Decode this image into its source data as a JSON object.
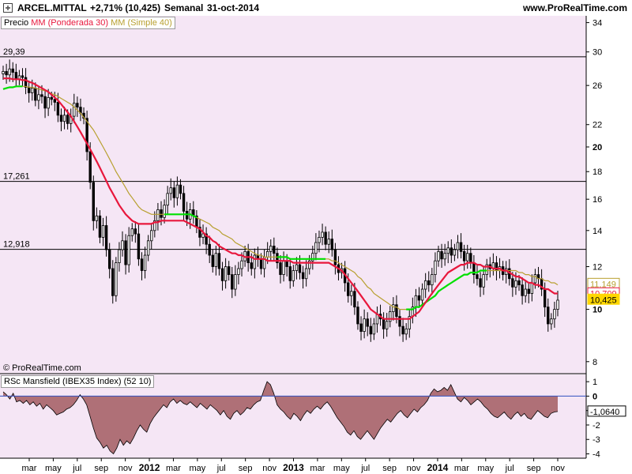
{
  "header": {
    "instrument": "ARCEL.MITTAL",
    "change": "+2,71% (10,425)",
    "period": "Semanal",
    "date": "31-oct-2014",
    "site": "www.ProRealTime.com"
  },
  "legend": {
    "price": "Precio",
    "ma30": "MM (Ponderada 30)",
    "ma40": "MM (Simple 40)",
    "rsc": "RSc Mansfield (IBEX35 Index) (52 10)"
  },
  "watermark": "© ProRealTime.com",
  "colors": {
    "background": "#f5e6f5",
    "candle_up": "#ffffff",
    "candle_down": "#000000",
    "ma30": "#e8173c",
    "ma40_up": "#00e000",
    "ma40": "#b8a030",
    "rsc_fill": "#a25a60",
    "rsc_fill_pos": "#7a9a7a",
    "price_tag": "#ffd700"
  },
  "icons": {
    "expand": "expand-icon"
  },
  "chart_data": [
    {
      "type": "candlestick",
      "title": "",
      "y_axis_ticks": [
        8,
        10,
        12,
        14,
        16,
        18,
        20,
        22,
        26,
        30,
        34
      ],
      "y_axis_bold": [
        10,
        20
      ],
      "ylim": [
        7.6,
        35
      ],
      "log_scale": true,
      "x_labels": [
        "mar",
        "may",
        "jul",
        "sep",
        "nov",
        "2012",
        "mar",
        "may",
        "jul",
        "sep",
        "nov",
        "2013",
        "mar",
        "may",
        "jul",
        "sep",
        "nov",
        "2014",
        "mar",
        "may",
        "jul",
        "sep",
        "nov"
      ],
      "x_bold": [
        "2012",
        "2013",
        "2014"
      ],
      "horizontal_lines": [
        {
          "value": 29.39,
          "label": "29,39"
        },
        {
          "value": 17.261,
          "label": "17,261"
        },
        {
          "value": 12.918,
          "label": "12,918"
        }
      ],
      "right_tags": [
        {
          "value": 11.149,
          "label": "11,149",
          "color": "#b8a030"
        },
        {
          "value": 10.709,
          "label": "10,709",
          "color": "#e8173c"
        },
        {
          "value": 10.425,
          "label": "10,425",
          "color": "#ffd700"
        }
      ],
      "close": [
        27.6,
        27.2,
        27.9,
        27.5,
        26.7,
        27.1,
        26.9,
        25.8,
        25.2,
        25.7,
        24.4,
        25.0,
        24.8,
        23.6,
        24.7,
        24.5,
        24.2,
        22.9,
        22.3,
        22.9,
        22.1,
        22.8,
        24.1,
        23.7,
        23.1,
        22.6,
        19.6,
        17.2,
        14.6,
        14.9,
        13.6,
        14.3,
        12.9,
        11.9,
        10.6,
        12.2,
        12.9,
        13.4,
        12.1,
        13.7,
        14.1,
        13.8,
        12.4,
        11.8,
        12.6,
        13.4,
        14.0,
        14.6,
        15.3,
        14.8,
        15.6,
        16.4,
        16.8,
        16.1,
        17.0,
        16.4,
        15.2,
        14.7,
        15.3,
        14.9,
        14.2,
        13.6,
        13.8,
        13.2,
        12.6,
        12.0,
        12.7,
        11.9,
        11.3,
        12.0,
        11.6,
        10.9,
        11.6,
        11.9,
        12.3,
        12.8,
        12.2,
        11.9,
        12.6,
        12.4,
        11.9,
        12.5,
        12.8,
        13.1,
        12.7,
        12.2,
        11.6,
        12.3,
        12.0,
        11.3,
        11.8,
        12.1,
        11.7,
        11.4,
        11.9,
        12.3,
        12.7,
        13.3,
        13.6,
        13.9,
        13.2,
        13.5,
        12.9,
        12.1,
        11.7,
        11.9,
        11.2,
        10.6,
        10.8,
        10.1,
        9.4,
        9.1,
        9.6,
        9.3,
        9.0,
        9.4,
        9.8,
        9.6,
        9.2,
        9.5,
        9.9,
        10.2,
        9.7,
        9.3,
        9.0,
        9.2,
        9.7,
        10.1,
        10.6,
        10.4,
        10.9,
        11.3,
        11.1,
        11.6,
        12.3,
        12.8,
        12.4,
        12.7,
        13.0,
        12.6,
        12.9,
        13.3,
        12.8,
        12.3,
        12.7,
        12.2,
        11.6,
        11.4,
        11.0,
        11.6,
        12.1,
        11.9,
        12.2,
        11.8,
        12.0,
        11.6,
        11.9,
        11.4,
        11.0,
        11.3,
        11.1,
        10.6,
        10.9,
        10.7,
        11.2,
        11.6,
        11.4,
        10.9,
        10.1,
        9.4,
        9.6,
        10.0,
        10.4
      ],
      "ma30": [
        26.8,
        26.8,
        26.8,
        26.7,
        26.7,
        26.7,
        26.6,
        26.6,
        26.4,
        26.3,
        26.1,
        25.9,
        25.7,
        25.5,
        25.3,
        25.0,
        24.7,
        24.4,
        24.0,
        23.6,
        23.2,
        22.8,
        22.3,
        21.8,
        21.3,
        20.8,
        20.3,
        19.8,
        19.3,
        18.8,
        18.3,
        17.8,
        17.3,
        16.8,
        16.4,
        16.0,
        15.6,
        15.3,
        15.0,
        14.8,
        14.6,
        14.5,
        14.4,
        14.4,
        14.4,
        14.4,
        14.4,
        14.5,
        14.5,
        14.6,
        14.6,
        14.6,
        14.6,
        14.6,
        14.6,
        14.6,
        14.6,
        14.5,
        14.4,
        14.3,
        14.2,
        14.1,
        13.9,
        13.7,
        13.6,
        13.4,
        13.3,
        13.1,
        13.0,
        12.9,
        12.8,
        12.7,
        12.7,
        12.6,
        12.6,
        12.5,
        12.5,
        12.5,
        12.4,
        12.4,
        12.4,
        12.4,
        12.3,
        12.3,
        12.3,
        12.3,
        12.3,
        12.3,
        12.3,
        12.3,
        12.2,
        12.2,
        12.2,
        12.2,
        12.2,
        12.2,
        12.2,
        12.2,
        12.2,
        12.2,
        12.2,
        12.2,
        12.1,
        12.0,
        11.9,
        11.8,
        11.6,
        11.4,
        11.2,
        11.0,
        10.8,
        10.6,
        10.4,
        10.2,
        10.0,
        9.9,
        9.8,
        9.7,
        9.6,
        9.6,
        9.6,
        9.6,
        9.6,
        9.6,
        9.6,
        9.6,
        9.6,
        9.7,
        9.8,
        9.9,
        10.1,
        10.3,
        10.5,
        10.7,
        10.9,
        11.1,
        11.3,
        11.5,
        11.7,
        11.8,
        11.9,
        12.0,
        12.1,
        12.1,
        12.2,
        12.2,
        12.2,
        12.1,
        12.1,
        12.0,
        12.0,
        12.0,
        11.9,
        11.9,
        11.9,
        11.8,
        11.8,
        11.7,
        11.6,
        11.5,
        11.5,
        11.4,
        11.3,
        11.2,
        11.2,
        11.1,
        11.1,
        11.0,
        10.9,
        10.9,
        10.8,
        10.7,
        10.7
      ],
      "ma40": [
        25.6,
        25.7,
        25.8,
        25.8,
        25.9,
        25.9,
        25.9,
        25.9,
        25.8,
        25.8,
        25.7,
        25.6,
        25.5,
        25.4,
        25.3,
        25.1,
        25.0,
        24.8,
        24.6,
        24.4,
        24.2,
        24.0,
        23.7,
        23.4,
        23.1,
        22.7,
        22.3,
        21.9,
        21.5,
        21.0,
        20.5,
        20.0,
        19.5,
        19.0,
        18.5,
        18.0,
        17.6,
        17.2,
        16.8,
        16.4,
        16.1,
        15.8,
        15.5,
        15.3,
        15.2,
        15.1,
        15.0,
        15.0,
        15.0,
        15.0,
        15.0,
        15.0,
        15.0,
        15.0,
        15.0,
        15.0,
        15.0,
        15.0,
        15.0,
        14.9,
        14.8,
        14.7,
        14.6,
        14.5,
        14.4,
        14.2,
        14.1,
        14.0,
        13.8,
        13.7,
        13.6,
        13.5,
        13.3,
        13.2,
        13.1,
        13.0,
        12.9,
        12.8,
        12.7,
        12.6,
        12.6,
        12.5,
        12.5,
        12.5,
        12.5,
        12.5,
        12.5,
        12.5,
        12.5,
        12.4,
        12.4,
        12.4,
        12.4,
        12.4,
        12.4,
        12.4,
        12.4,
        12.4,
        12.4,
        12.4,
        12.4,
        12.4,
        12.3,
        12.3,
        12.2,
        12.1,
        12.0,
        11.9,
        11.8,
        11.7,
        11.5,
        11.4,
        11.2,
        11.0,
        10.9,
        10.7,
        10.6,
        10.5,
        10.4,
        10.3,
        10.2,
        10.1,
        10.1,
        10.0,
        10.0,
        10.0,
        10.0,
        10.0,
        10.1,
        10.1,
        10.2,
        10.3,
        10.4,
        10.5,
        10.6,
        10.8,
        10.9,
        11.0,
        11.1,
        11.2,
        11.3,
        11.4,
        11.5,
        11.6,
        11.6,
        11.7,
        11.7,
        11.7,
        11.8,
        11.8,
        11.8,
        11.8,
        11.8,
        11.8,
        11.8,
        11.8,
        11.8,
        11.8,
        11.8,
        11.8,
        11.7,
        11.7,
        11.6,
        11.6,
        11.5,
        11.5,
        11.4,
        11.4,
        11.3,
        11.3,
        11.2,
        11.2,
        11.1
      ],
      "ma40_green_ranges": [
        [
          0,
          6
        ],
        [
          50,
          60
        ],
        [
          85,
          100
        ],
        [
          125,
          150
        ]
      ]
    },
    {
      "type": "area",
      "title": "RSc Mansfield (IBEX35 Index) (52 10)",
      "y_axis_ticks": [
        1,
        0,
        -1,
        -2,
        -3,
        -4
      ],
      "y_axis_bold": [
        0
      ],
      "ylim": [
        -4.3,
        1.5
      ],
      "right_tag": {
        "value": -1.064,
        "label": "-1,0640"
      },
      "values": [
        0.3,
        0.1,
        -0.2,
        0.2,
        -0.4,
        -0.3,
        -0.5,
        -0.3,
        -0.6,
        -0.4,
        -0.7,
        -0.5,
        -0.9,
        -0.6,
        -0.8,
        -1.0,
        -1.3,
        -1.2,
        -1.1,
        -0.9,
        -0.8,
        -0.6,
        -0.3,
        0.1,
        -0.2,
        -0.6,
        -1.4,
        -2.2,
        -2.9,
        -3.2,
        -3.6,
        -3.4,
        -3.8,
        -4.0,
        -3.6,
        -3.0,
        -3.4,
        -3.1,
        -3.3,
        -2.9,
        -2.4,
        -2.0,
        -2.3,
        -2.5,
        -1.9,
        -1.5,
        -1.2,
        -0.9,
        -0.6,
        -0.8,
        -0.4,
        -0.2,
        -0.5,
        -0.3,
        -0.5,
        -0.6,
        -0.4,
        -0.6,
        -0.8,
        -0.5,
        -0.7,
        -0.9,
        -0.6,
        -0.8,
        -1.0,
        -1.3,
        -1.0,
        -1.4,
        -1.6,
        -1.2,
        -1.0,
        -1.3,
        -1.1,
        -0.8,
        -0.9,
        -0.6,
        -0.4,
        -0.3,
        0.4,
        1.0,
        0.8,
        0.2,
        -0.6,
        -0.9,
        -1.1,
        -1.4,
        -1.6,
        -1.2,
        -1.4,
        -1.7,
        -1.3,
        -1.0,
        -1.2,
        -0.9,
        -0.7,
        -0.9,
        -0.6,
        -0.4,
        -0.7,
        -1.1,
        -1.5,
        -1.8,
        -2.1,
        -2.5,
        -2.7,
        -2.4,
        -2.8,
        -3.0,
        -2.7,
        -2.4,
        -2.7,
        -3.0,
        -2.6,
        -2.2,
        -1.9,
        -1.6,
        -1.8,
        -1.5,
        -1.2,
        -1.0,
        -1.3,
        -1.5,
        -1.2,
        -0.9,
        -1.1,
        -0.8,
        -0.6,
        -0.3,
        0.2,
        0.5,
        0.3,
        0.4,
        0.6,
        0.4,
        0.8,
        0.3,
        -0.2,
        -0.4,
        -0.1,
        -0.3,
        -0.6,
        -0.4,
        -0.2,
        -0.4,
        -0.7,
        -0.9,
        -1.2,
        -1.4,
        -1.5,
        -1.3,
        -1.1,
        -1.4,
        -1.6,
        -1.3,
        -1.1,
        -1.4,
        -1.2,
        -1.5,
        -1.6,
        -1.3,
        -1.0,
        -1.2,
        -1.4,
        -1.5,
        -1.2,
        -1.1,
        -1.064
      ]
    }
  ]
}
